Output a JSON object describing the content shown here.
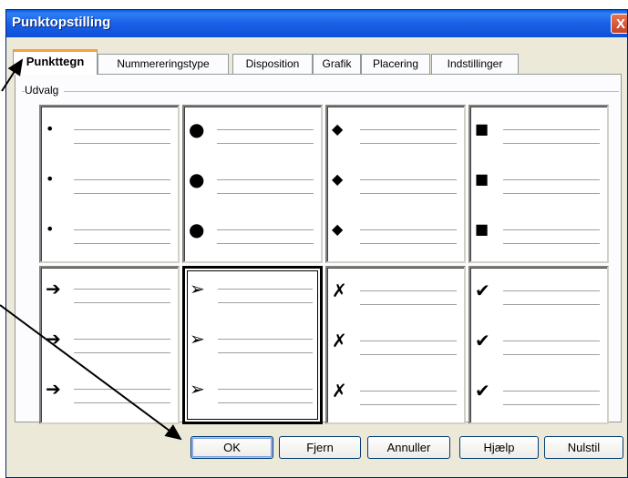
{
  "window": {
    "title": "Punktopstilling",
    "close_glyph": "X"
  },
  "tabs": [
    {
      "label": "Punkttegn",
      "active": true
    },
    {
      "label": "Nummereringstype",
      "active": false
    },
    {
      "label": "Disposition",
      "active": false
    },
    {
      "label": "Grafik",
      "active": false
    },
    {
      "label": "Placering",
      "active": false
    },
    {
      "label": "Indstillinger",
      "active": false
    }
  ],
  "selection_group": {
    "label": "Udvalg"
  },
  "bullet_options": [
    {
      "glyph": "•",
      "icon": "small-dot-icon",
      "selected": false
    },
    {
      "glyph": "●",
      "icon": "large-dot-icon",
      "selected": false
    },
    {
      "glyph": "◆",
      "icon": "diamond-icon",
      "selected": false
    },
    {
      "glyph": "■",
      "icon": "square-icon",
      "selected": false
    },
    {
      "glyph": "➔",
      "icon": "arrow-icon",
      "selected": false
    },
    {
      "glyph": "➢",
      "icon": "arrowhead-icon",
      "selected": true
    },
    {
      "glyph": "✗",
      "icon": "cross-icon",
      "selected": false
    },
    {
      "glyph": "✔",
      "icon": "checkmark-icon",
      "selected": false
    }
  ],
  "buttons": {
    "ok": "OK",
    "remove": "Fjern",
    "cancel": "Annuller",
    "help": "Hjælp",
    "reset": "Nulstil"
  },
  "colors": {
    "titlebar": "#0b4fd6",
    "dialog_bg": "#ece9d8",
    "active_tab_accent": "#f4a33b",
    "annotation_arrows": "#000000"
  }
}
